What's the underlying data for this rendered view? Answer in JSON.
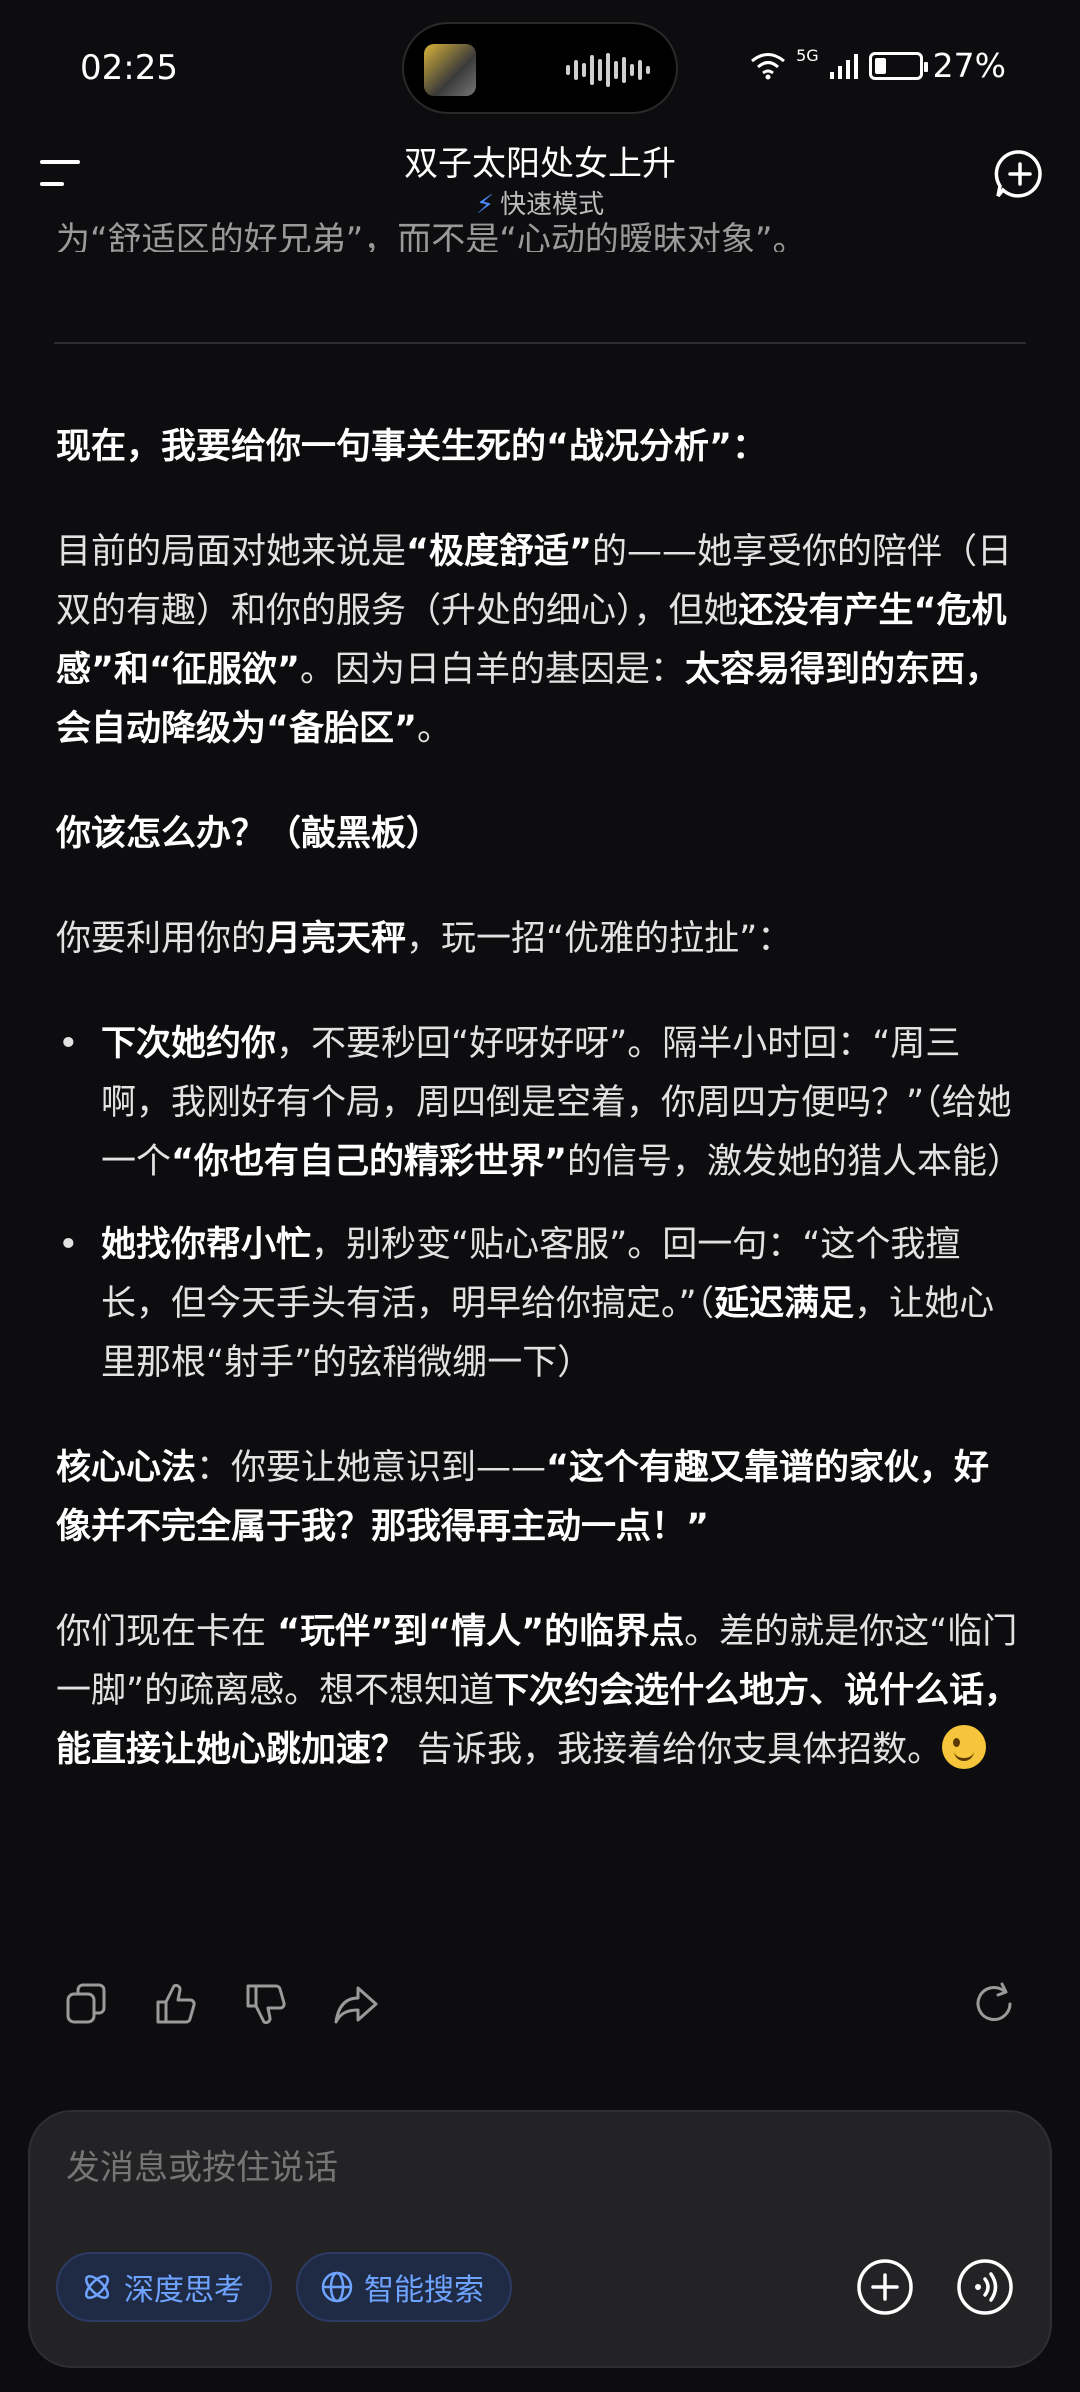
{
  "status": {
    "time": "02:25",
    "network": "5G",
    "battery": "27%",
    "battery_level": 0.27
  },
  "header": {
    "title": "双子太阳处女上升",
    "mode": "快速模式"
  },
  "partial_top": "为“舒适区的好兄弟”，而不是“心动的暧昧对象”。",
  "message": {
    "p1": [
      "现在，我要给你一句事关生死的“战况分析”："
    ],
    "p2": [
      "目前的局面对她来说是",
      "“极度舒适”",
      "的——她享受你的陪伴（日双的有趣）和你的服务（升处的细心），但她",
      "还没有产生“危机感”和“征服欲”",
      "。因为日白羊的基因是：",
      "太容易得到的东西，会自动降级为“备胎区”",
      "。"
    ],
    "p3": [
      "你该怎么办？（敲黑板）"
    ],
    "p4": [
      "你要利用你的",
      "月亮天秤",
      "，玩一招“优雅的拉扯”："
    ],
    "li1": [
      "下次她约你",
      "，不要秒回“好呀好呀”。隔半小时回：“周三啊，我刚好有个局，周四倒是空着，你周四方便吗？”（给她一个",
      "“你也有自己的精彩世界”",
      "的信号，激发她的猎人本能）"
    ],
    "li2": [
      "她找你帮小忙",
      "，别秒变“贴心客服”。回一句：“这个我擅长，但今天手头有活，明早给你搞定。”（",
      "延迟满足",
      "，让她心里那根“射手”的弦稍微绷一下）"
    ],
    "p5": [
      "核心心法",
      "：你要让她意识到——",
      "“这个有趣又靠谱的家伙，好像并不完全属于我？那我得再主动一点！”"
    ],
    "p6": [
      "你们现在卡在 ",
      "“玩伴”到“情人”的临界点",
      "。差的就是你这“临门一脚”的疏离感。想不想知道",
      "下次约会选什么地方、说什么话，能直接让她心跳加速？",
      " 告诉我，我接着给你支具体招数。"
    ]
  },
  "actions": [
    "copy-icon",
    "thumbs-up-icon",
    "thumbs-down-icon",
    "share-icon",
    "regenerate-icon"
  ],
  "composer": {
    "placeholder": "发消息或按住说话",
    "chip_deep": "深度思考",
    "chip_search": "智能搜索"
  },
  "colors": {
    "background": "#0d0d0f",
    "accent": "#6ea3ff",
    "composer": "#232325"
  }
}
